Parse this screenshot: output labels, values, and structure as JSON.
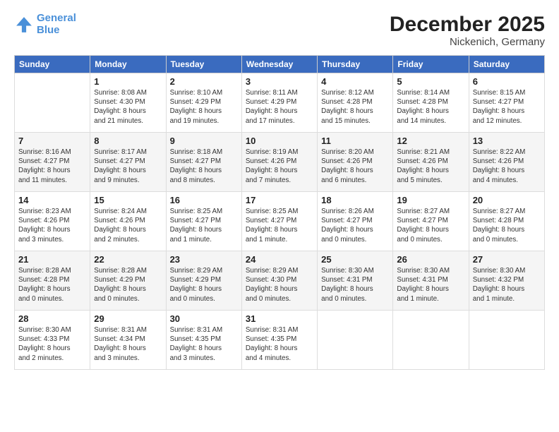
{
  "header": {
    "logo_line1": "General",
    "logo_line2": "Blue",
    "month": "December 2025",
    "location": "Nickenich, Germany"
  },
  "weekdays": [
    "Sunday",
    "Monday",
    "Tuesday",
    "Wednesday",
    "Thursday",
    "Friday",
    "Saturday"
  ],
  "weeks": [
    [
      {
        "day": null,
        "info": null
      },
      {
        "day": "1",
        "info": "Sunrise: 8:08 AM\nSunset: 4:30 PM\nDaylight: 8 hours\nand 21 minutes."
      },
      {
        "day": "2",
        "info": "Sunrise: 8:10 AM\nSunset: 4:29 PM\nDaylight: 8 hours\nand 19 minutes."
      },
      {
        "day": "3",
        "info": "Sunrise: 8:11 AM\nSunset: 4:29 PM\nDaylight: 8 hours\nand 17 minutes."
      },
      {
        "day": "4",
        "info": "Sunrise: 8:12 AM\nSunset: 4:28 PM\nDaylight: 8 hours\nand 15 minutes."
      },
      {
        "day": "5",
        "info": "Sunrise: 8:14 AM\nSunset: 4:28 PM\nDaylight: 8 hours\nand 14 minutes."
      },
      {
        "day": "6",
        "info": "Sunrise: 8:15 AM\nSunset: 4:27 PM\nDaylight: 8 hours\nand 12 minutes."
      }
    ],
    [
      {
        "day": "7",
        "info": "Sunrise: 8:16 AM\nSunset: 4:27 PM\nDaylight: 8 hours\nand 11 minutes."
      },
      {
        "day": "8",
        "info": "Sunrise: 8:17 AM\nSunset: 4:27 PM\nDaylight: 8 hours\nand 9 minutes."
      },
      {
        "day": "9",
        "info": "Sunrise: 8:18 AM\nSunset: 4:27 PM\nDaylight: 8 hours\nand 8 minutes."
      },
      {
        "day": "10",
        "info": "Sunrise: 8:19 AM\nSunset: 4:26 PM\nDaylight: 8 hours\nand 7 minutes."
      },
      {
        "day": "11",
        "info": "Sunrise: 8:20 AM\nSunset: 4:26 PM\nDaylight: 8 hours\nand 6 minutes."
      },
      {
        "day": "12",
        "info": "Sunrise: 8:21 AM\nSunset: 4:26 PM\nDaylight: 8 hours\nand 5 minutes."
      },
      {
        "day": "13",
        "info": "Sunrise: 8:22 AM\nSunset: 4:26 PM\nDaylight: 8 hours\nand 4 minutes."
      }
    ],
    [
      {
        "day": "14",
        "info": "Sunrise: 8:23 AM\nSunset: 4:26 PM\nDaylight: 8 hours\nand 3 minutes."
      },
      {
        "day": "15",
        "info": "Sunrise: 8:24 AM\nSunset: 4:26 PM\nDaylight: 8 hours\nand 2 minutes."
      },
      {
        "day": "16",
        "info": "Sunrise: 8:25 AM\nSunset: 4:27 PM\nDaylight: 8 hours\nand 1 minute."
      },
      {
        "day": "17",
        "info": "Sunrise: 8:25 AM\nSunset: 4:27 PM\nDaylight: 8 hours\nand 1 minute."
      },
      {
        "day": "18",
        "info": "Sunrise: 8:26 AM\nSunset: 4:27 PM\nDaylight: 8 hours\nand 0 minutes."
      },
      {
        "day": "19",
        "info": "Sunrise: 8:27 AM\nSunset: 4:27 PM\nDaylight: 8 hours\nand 0 minutes."
      },
      {
        "day": "20",
        "info": "Sunrise: 8:27 AM\nSunset: 4:28 PM\nDaylight: 8 hours\nand 0 minutes."
      }
    ],
    [
      {
        "day": "21",
        "info": "Sunrise: 8:28 AM\nSunset: 4:28 PM\nDaylight: 8 hours\nand 0 minutes."
      },
      {
        "day": "22",
        "info": "Sunrise: 8:28 AM\nSunset: 4:29 PM\nDaylight: 8 hours\nand 0 minutes."
      },
      {
        "day": "23",
        "info": "Sunrise: 8:29 AM\nSunset: 4:29 PM\nDaylight: 8 hours\nand 0 minutes."
      },
      {
        "day": "24",
        "info": "Sunrise: 8:29 AM\nSunset: 4:30 PM\nDaylight: 8 hours\nand 0 minutes."
      },
      {
        "day": "25",
        "info": "Sunrise: 8:30 AM\nSunset: 4:31 PM\nDaylight: 8 hours\nand 0 minutes."
      },
      {
        "day": "26",
        "info": "Sunrise: 8:30 AM\nSunset: 4:31 PM\nDaylight: 8 hours\nand 1 minute."
      },
      {
        "day": "27",
        "info": "Sunrise: 8:30 AM\nSunset: 4:32 PM\nDaylight: 8 hours\nand 1 minute."
      }
    ],
    [
      {
        "day": "28",
        "info": "Sunrise: 8:30 AM\nSunset: 4:33 PM\nDaylight: 8 hours\nand 2 minutes."
      },
      {
        "day": "29",
        "info": "Sunrise: 8:31 AM\nSunset: 4:34 PM\nDaylight: 8 hours\nand 3 minutes."
      },
      {
        "day": "30",
        "info": "Sunrise: 8:31 AM\nSunset: 4:35 PM\nDaylight: 8 hours\nand 3 minutes."
      },
      {
        "day": "31",
        "info": "Sunrise: 8:31 AM\nSunset: 4:35 PM\nDaylight: 8 hours\nand 4 minutes."
      },
      {
        "day": null,
        "info": null
      },
      {
        "day": null,
        "info": null
      },
      {
        "day": null,
        "info": null
      }
    ]
  ]
}
